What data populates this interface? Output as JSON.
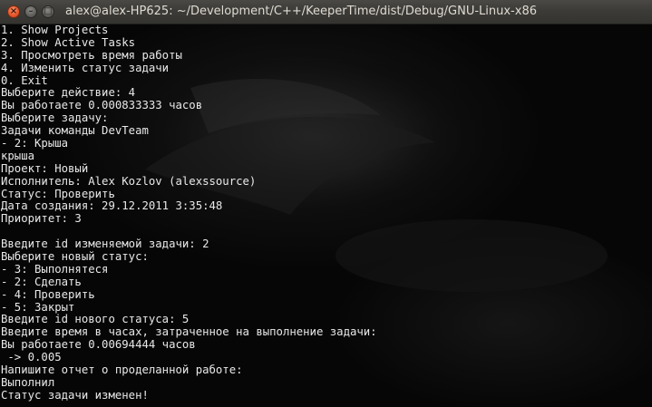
{
  "window": {
    "title": "alex@alex-HP625: ~/Development/C++/KeeperTime/dist/Debug/GNU-Linux-x86",
    "close_glyph": "×",
    "minimize_glyph": "–",
    "maximize_glyph": "□"
  },
  "terminal": {
    "lines": [
      "1. Show Projects",
      "2. Show Active Tasks",
      "3. Просмотреть время работы",
      "4. Изменить статус задачи",
      "0. Exit",
      "Выберите действие: 4",
      "Вы работаете 0.000833333 часов",
      "Выберите задачу:",
      "Задачи команды DevTeam",
      "- 2: Крыша",
      "крыша",
      "Проект: Новый",
      "Исполнитель: Alex Kozlov (alexssource)",
      "Статус: Проверить",
      "Дата создания: 29.12.2011 3:35:48",
      "Приоритет: 3",
      "",
      "Введите id изменяемой задачи: 2",
      "Выберите новый статус:",
      "- 3: Выполнятеся",
      "- 2: Сделать",
      "- 4: Проверить",
      "- 5: Закрыт",
      "Введите id нового статуса: 5",
      "Введите время в часах, затраченное на выполнение задачи:",
      "Вы работаете 0.00694444 часов",
      " -> 0.005",
      "Напишите отчет о проделанной работе:",
      "Выполнил",
      "Статус задачи изменен!"
    ]
  },
  "colors": {
    "titlebar": "#3c3b37",
    "title_text": "#dfdbd2",
    "close_button": "#e8582c",
    "terminal_bg": "#060606",
    "terminal_text": "#e8e8e8"
  }
}
